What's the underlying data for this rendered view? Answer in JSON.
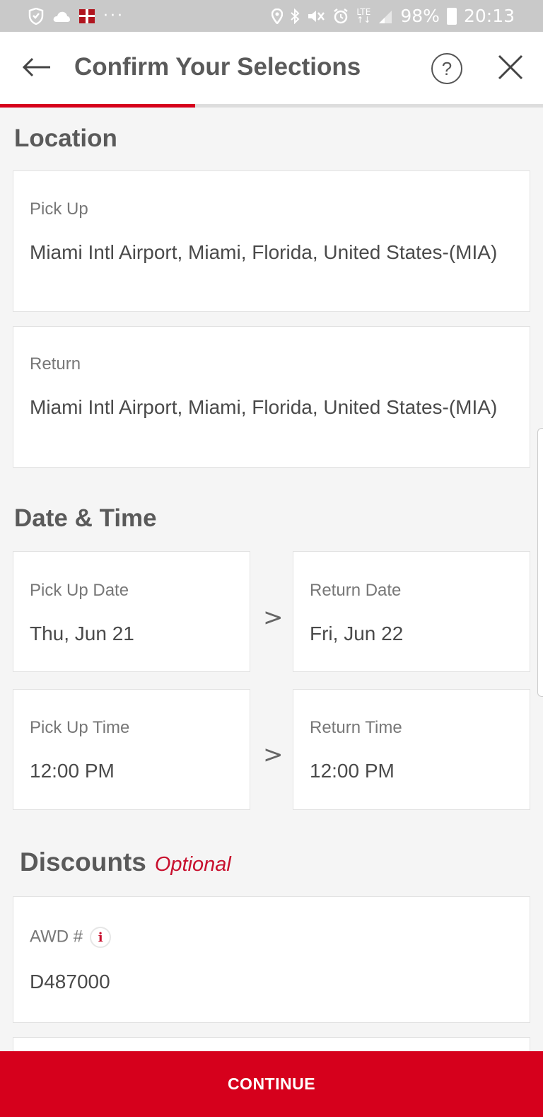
{
  "status_bar": {
    "left_icons": [
      "shield-icon",
      "cloud-icon",
      "gift-icon",
      "more-icon"
    ],
    "right_icons": [
      "location-icon",
      "bluetooth-icon",
      "mute-icon",
      "alarm-icon",
      "lte-icon",
      "signal-icon",
      "battery-icon"
    ],
    "battery": "98%",
    "time": "20:13",
    "lte_label": "LTE"
  },
  "header": {
    "title": "Confirm Your Selections",
    "help_glyph": "?",
    "progress_fraction": 0.36,
    "accent_color": "#d6001c"
  },
  "location": {
    "title": "Location",
    "pickup_label": "Pick Up",
    "pickup_value": "Miami Intl Airport, Miami, Florida, United States-(MIA)",
    "return_label": "Return",
    "return_value": "Miami Intl Airport, Miami, Florida, United States-(MIA)"
  },
  "datetime": {
    "title": "Date & Time",
    "pickup_date_label": "Pick Up Date",
    "pickup_date_value": "Thu, Jun 21",
    "return_date_label": "Return Date",
    "return_date_value": "Fri, Jun 22",
    "pickup_time_label": "Pick Up Time",
    "pickup_time_value": "12:00 PM",
    "return_time_label": "Return Time",
    "return_time_value": "12:00 PM",
    "arrow": ">"
  },
  "discounts": {
    "title": "Discounts",
    "optional_label": "Optional",
    "awd_label": "AWD #",
    "awd_value": "D487000",
    "info_glyph": "i"
  },
  "footer": {
    "continue_label": "CONTINUE"
  }
}
